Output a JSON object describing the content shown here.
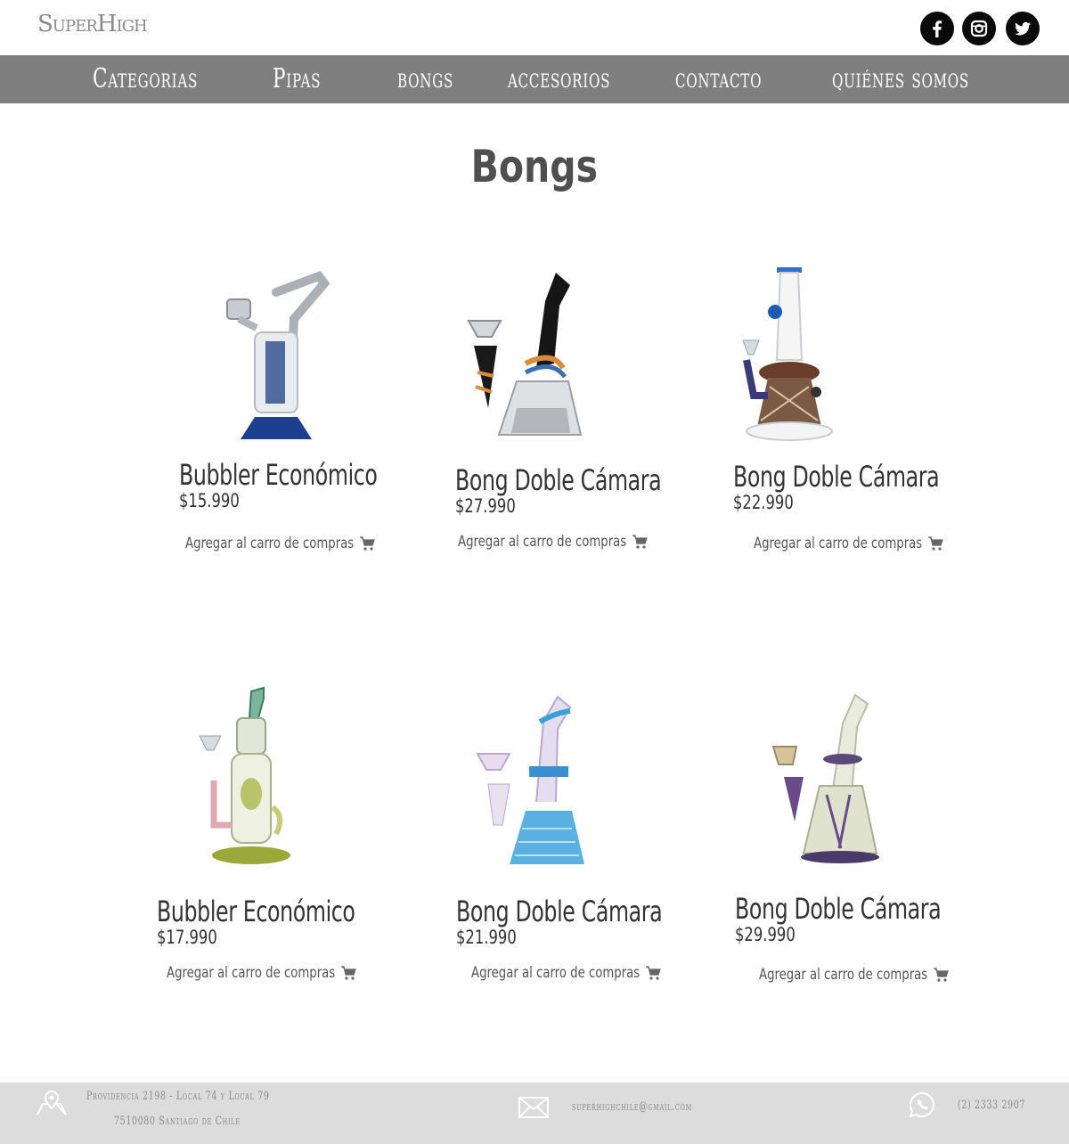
{
  "header": {
    "logo": "SuperHigh",
    "social": [
      {
        "name": "facebook-icon"
      },
      {
        "name": "instagram-icon"
      },
      {
        "name": "twitter-icon"
      }
    ]
  },
  "nav": {
    "items": [
      "Categorias",
      "Pipas",
      "bongs",
      "accesorios",
      "contacto",
      "quiénes somos"
    ]
  },
  "page": {
    "title": "Bongs"
  },
  "cart_label": "Agregar al carro de compras",
  "products": [
    {
      "name": "Bubbler Económico",
      "price": "$15.990",
      "add_label": "Agregar al carro de compras",
      "image": "bubbler-blue-clear"
    },
    {
      "name": "Bong Doble Cámara",
      "price": "$27.990",
      "add_label": "Agregar al carro de compras",
      "image": "bong-black-swirl"
    },
    {
      "name": "Bong Doble Cámara",
      "price": "$22.990",
      "add_label": "Agregar al carro de compras",
      "image": "bong-white-purple"
    },
    {
      "name": "Bubbler Económico",
      "price": "$17.990",
      "add_label": "Agregar al carro de compras",
      "image": "bubbler-green-recycler"
    },
    {
      "name": "Bong Doble Cámara",
      "price": "$21.990",
      "add_label": "Agregar al carro de compras",
      "image": "bong-blue-glass"
    },
    {
      "name": "Bong Doble Cámara",
      "price": "$29.990",
      "add_label": "Agregar al carro de compras",
      "image": "bong-pale-cone"
    }
  ],
  "footer": {
    "address_line1": "Providencia 2198 - Local 74 y Local 79",
    "address_line2": "7510080 Santiago de Chile",
    "email": "superhighchile@gmail.com",
    "phone": "(2) 2333 2907"
  },
  "colors": {
    "nav_bg": "#7f7f7f",
    "footer_bg": "#dcdcdc",
    "social_bg": "#0a0a0a"
  }
}
